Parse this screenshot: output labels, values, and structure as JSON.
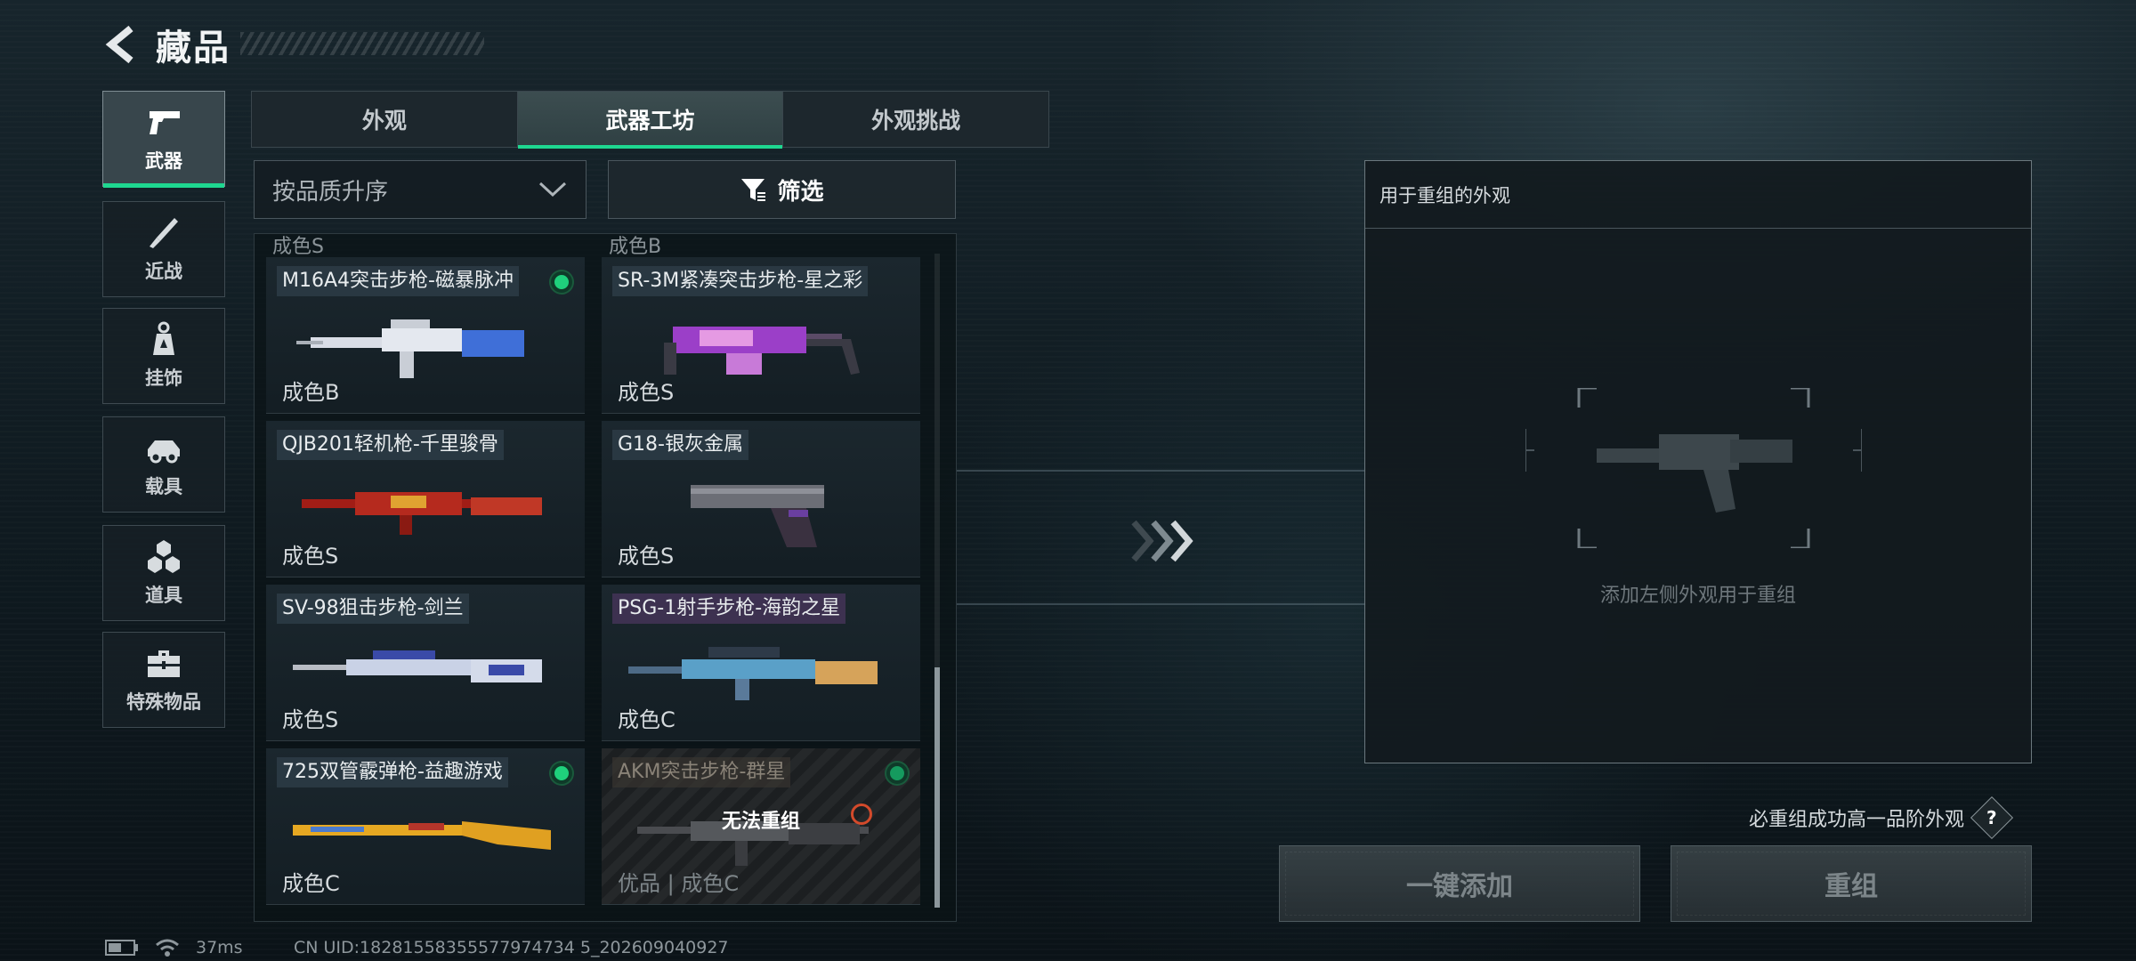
{
  "header": {
    "title": "藏品"
  },
  "categories": [
    {
      "label": "武器",
      "icon": "pistol-icon",
      "active": true
    },
    {
      "label": "近战",
      "icon": "knife-icon",
      "active": false
    },
    {
      "label": "挂饰",
      "icon": "charm-icon",
      "active": false
    },
    {
      "label": "载具",
      "icon": "vehicle-icon",
      "active": false
    },
    {
      "label": "道具",
      "icon": "cubes-icon",
      "active": false
    },
    {
      "label": "特殊物品",
      "icon": "toolbox-icon",
      "active": false
    }
  ],
  "tabs": [
    {
      "label": "外观",
      "active": false
    },
    {
      "label": "武器工坊",
      "active": true
    },
    {
      "label": "外观挑战",
      "active": false
    }
  ],
  "sort": {
    "label": "按品质升序"
  },
  "filter": {
    "label": "筛选"
  },
  "grid": {
    "cut_labels": [
      "成色S",
      "成色B"
    ],
    "items": [
      {
        "name": "M16A4突击步枪-磁暴脉冲",
        "condition": "成色B",
        "selected": true,
        "tint": "blue",
        "colors": [
          "#d9dde6",
          "#3f6fd8"
        ]
      },
      {
        "name": "SR-3M紧凑突击步枪-星之彩",
        "condition": "成色S",
        "selected": false,
        "tint": "blue",
        "colors": [
          "#9b3fc8",
          "#e59ae3"
        ]
      },
      {
        "name": "QJB201轻机枪-千里骏骨",
        "condition": "成色S",
        "selected": false,
        "tint": "blue",
        "colors": [
          "#a11d16",
          "#e0a331"
        ]
      },
      {
        "name": "G18-银灰金属",
        "condition": "成色S",
        "selected": false,
        "tint": "blue",
        "colors": [
          "#6c6e76",
          "#3a3140"
        ]
      },
      {
        "name": "SV-98狙击步枪-剑兰",
        "condition": "成色S",
        "selected": false,
        "tint": "blue",
        "colors": [
          "#c9d2e6",
          "#3a4aa8"
        ]
      },
      {
        "name": "PSG-1射手步枪-海韵之星",
        "condition": "成色C",
        "selected": false,
        "tint": "purple",
        "colors": [
          "#5aa0c8",
          "#d6a35a"
        ]
      },
      {
        "name": "725双管霰弹枪-益趣游戏",
        "condition": "成色C",
        "selected": true,
        "tint": "blue",
        "colors": [
          "#e6a822",
          "#4a7bd0"
        ]
      },
      {
        "name": "AKM突击步枪-群星",
        "condition": "优品 | 成色C",
        "selected": true,
        "tint": "disabled",
        "overlay": "无法重组",
        "colors": [
          "#4a4c50",
          "#2c2e31"
        ]
      }
    ]
  },
  "panel": {
    "title": "用于重组的外观",
    "hint": "添加左侧外观用于重组"
  },
  "guarantee": {
    "text": "必重组成功高一品阶外观",
    "help": "?"
  },
  "buttons": {
    "add_all": "一键添加",
    "recombine": "重组"
  },
  "status": {
    "ping": "37ms",
    "uid": "CN UID:18281558355577974734 5_202609040927"
  },
  "colors": {
    "accent": "#1ed790",
    "selected_dot": "#1fd07c"
  }
}
